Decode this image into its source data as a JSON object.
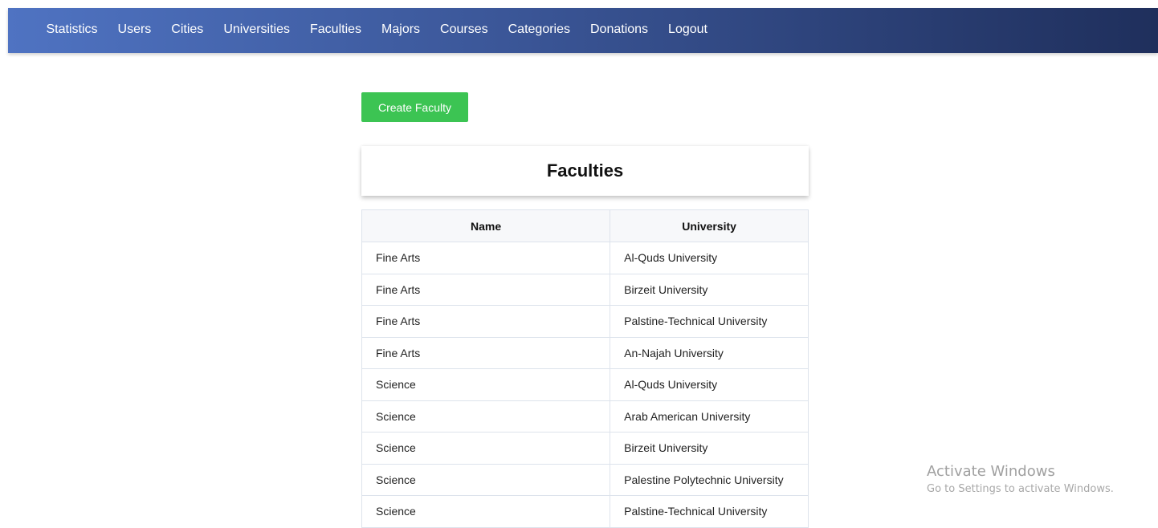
{
  "nav": {
    "items": [
      {
        "label": "Statistics"
      },
      {
        "label": "Users"
      },
      {
        "label": "Cities"
      },
      {
        "label": "Universities"
      },
      {
        "label": "Faculties"
      },
      {
        "label": "Majors"
      },
      {
        "label": "Courses"
      },
      {
        "label": "Categories"
      },
      {
        "label": "Donations"
      },
      {
        "label": "Logout"
      }
    ]
  },
  "actions": {
    "create_label": "Create Faculty"
  },
  "page": {
    "title": "Faculties"
  },
  "table": {
    "headers": [
      "Name",
      "University"
    ],
    "rows": [
      [
        "Fine Arts",
        "Al-Quds University"
      ],
      [
        "Fine Arts",
        "Birzeit University"
      ],
      [
        "Fine Arts",
        "Palstine-Technical University"
      ],
      [
        "Fine Arts",
        "An-Najah University"
      ],
      [
        "Science",
        "Al-Quds University"
      ],
      [
        "Science",
        "Arab American University"
      ],
      [
        "Science",
        "Birzeit University"
      ],
      [
        "Science",
        "Palestine Polytechnic University"
      ],
      [
        "Science",
        "Palstine-Technical University"
      ]
    ]
  },
  "watermark": {
    "title": "Activate Windows",
    "subtitle": "Go to Settings to activate Windows."
  },
  "colors": {
    "nav_gradient_start": "#4f73c2",
    "nav_gradient_end": "#1f2f5c",
    "create_button": "#3cc453"
  }
}
